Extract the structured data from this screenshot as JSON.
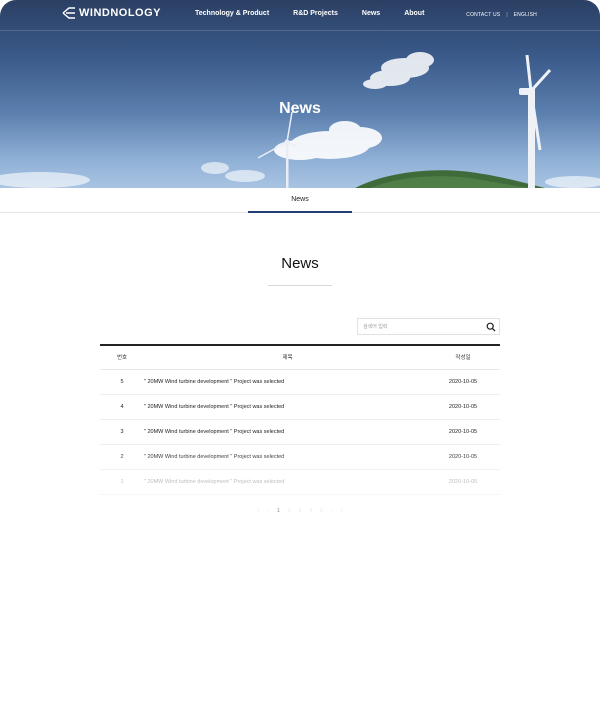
{
  "header": {
    "logo_text": "WINDNOLOGY",
    "nav": [
      "Technology & Product",
      "R&D Projects",
      "News",
      "About"
    ],
    "util": {
      "contact": "CONTACT US",
      "separator": "|",
      "language": "ENGLISH"
    }
  },
  "hero": {
    "title": "News"
  },
  "subtab": {
    "label": "News"
  },
  "section": {
    "title": "News"
  },
  "search": {
    "placeholder": "검색어 입력"
  },
  "table": {
    "headers": {
      "num": "번호",
      "title": "제목",
      "date": "작성일"
    },
    "rows": [
      {
        "num": "5",
        "title": "\" 20MW Wind turbine development \" Project was selected",
        "date": "2020-10-05"
      },
      {
        "num": "4",
        "title": "\" 20MW Wind turbine development \" Project was selected",
        "date": "2020-10-05"
      },
      {
        "num": "3",
        "title": "\" 20MW Wind turbine development \" Project was selected",
        "date": "2020-10-05"
      },
      {
        "num": "2",
        "title": "\" 20MW Wind turbine development \" Project was selected",
        "date": "2020-10-05"
      },
      {
        "num": "1",
        "title": "\" 20MW Wind turbine development \" Project was selected",
        "date": "2020-10-05"
      }
    ]
  },
  "pagination": {
    "first": "«",
    "prev": "‹",
    "pages": [
      "1",
      "2",
      "3",
      "4",
      "5"
    ],
    "next": "›",
    "last": "»",
    "current": "1"
  },
  "colors": {
    "accent": "#1f3f74",
    "header_text": "#ffffff"
  }
}
